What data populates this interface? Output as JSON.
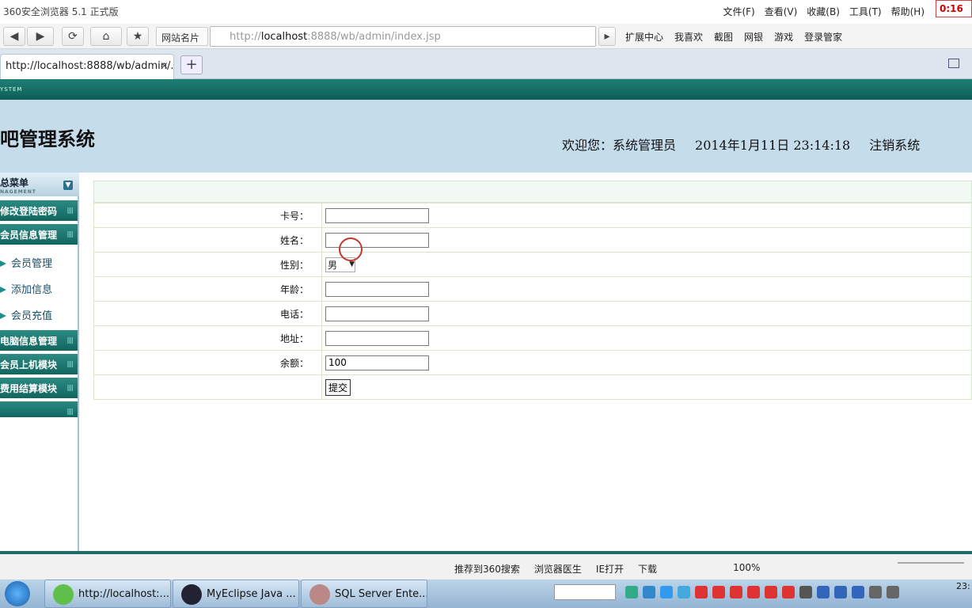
{
  "browser": {
    "title": "360安全浏览器 5.1 正式版",
    "menu": [
      "文件(F)",
      "查看(V)",
      "收藏(B)",
      "工具(T)",
      "帮助(H)"
    ],
    "clock": "0:16",
    "sitecard": "网站名片",
    "url_prefix": "http://",
    "url_host": "localhost",
    "url_rest": ":8888/wb/admin/index.jsp",
    "toolbar": [
      "扩展中心",
      "我喜欢",
      "截图",
      "网银",
      "游戏",
      "登录管家"
    ],
    "tab_title": "http://localhost:8888/wb/admin/...",
    "tab_close": "×",
    "newtab": "+"
  },
  "page": {
    "strip_text": "YSTEM",
    "system_title": "吧管理系统",
    "welcome": "欢迎您：系统管理员",
    "datetime": "2014年1月11日  23:14:18",
    "logout": "注销系统",
    "menu_head": "总菜单",
    "menu_head_sub": "NAGEMENT",
    "menu": {
      "change_password": "修改登陆密码",
      "member_info": "会员信息管理",
      "member_manage": "会员管理",
      "add_info": "添加信息",
      "member_recharge": "会员充值",
      "pc_info": "电脑信息管理",
      "member_online": "会员上机模块",
      "fee_settle": "费用结算模块"
    },
    "grip": "||||",
    "form": {
      "card_label": "卡号：",
      "name_label": "姓名：",
      "gender_label": "性别：",
      "gender_value": "男",
      "age_label": "年龄：",
      "phone_label": "电话：",
      "address_label": "地址：",
      "balance_label": "余额：",
      "balance_value": "100",
      "submit": "提交"
    }
  },
  "statusbar": {
    "items": [
      "推荐到360搜索",
      "浏览器医生",
      "IE打开",
      "下载"
    ],
    "zoom": "100%"
  },
  "taskbar": {
    "items": [
      "http://localhost:...",
      "MyEclipse Java ...",
      "SQL Server Ente..."
    ],
    "clock": "23:"
  }
}
